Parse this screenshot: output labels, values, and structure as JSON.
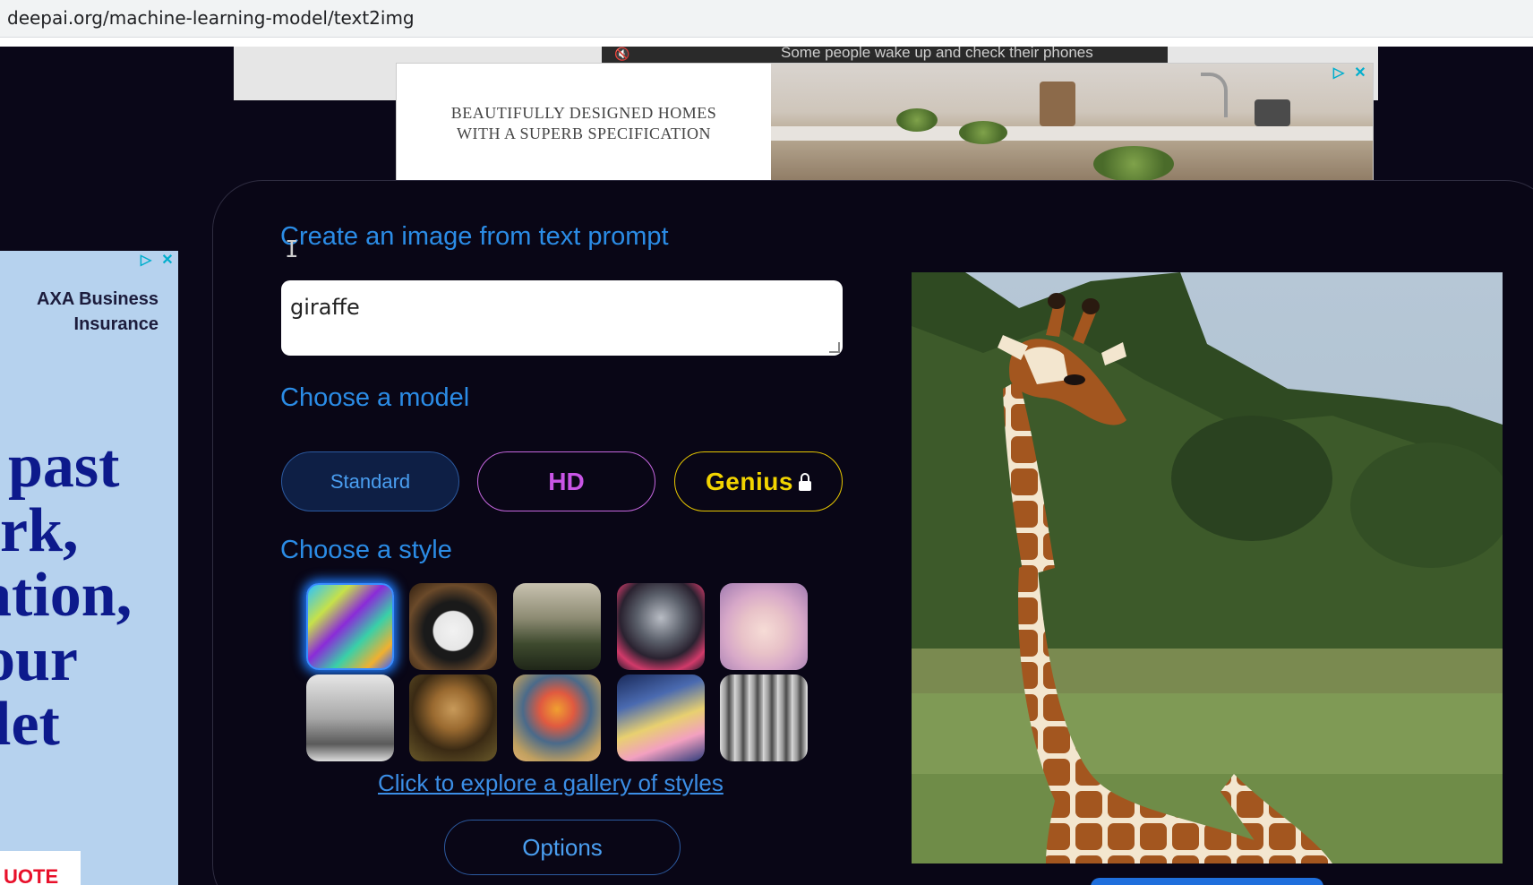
{
  "browser": {
    "url": "deepai.org/machine-learning-model/text2img"
  },
  "top_ad": {
    "video_caption": "Some people wake up and check their phones",
    "line1": "BEAUTIFULLY DESIGNED HOMES",
    "line2": "WITH A SUPERB SPECIFICATION"
  },
  "side_ad": {
    "company": "AXA Business Insurance",
    "headline_lines": [
      "past",
      "rk,",
      "ation,",
      "our",
      "let"
    ],
    "cta": "UOTE"
  },
  "main": {
    "heading": "Create an image from text prompt",
    "prompt_value": "giraffe",
    "model_heading": "Choose a model",
    "models": {
      "standard": "Standard",
      "hd": "HD",
      "genius": "Genius"
    },
    "style_heading": "Choose a style",
    "gallery_link": "Click to explore a gallery of styles",
    "options_label": "Options"
  },
  "colors": {
    "accent": "#2b8ce6",
    "hd": "#c955e6",
    "genius": "#f2d400",
    "background": "#0a0718"
  }
}
